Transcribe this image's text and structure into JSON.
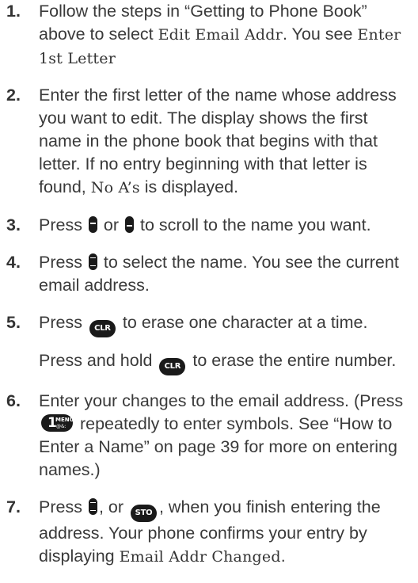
{
  "steps": [
    {
      "number": "1.",
      "text_a": "Follow the steps in “Getting to Phone Book” above to select ",
      "mono_a": "Edit Email Addr",
      "text_b": ". You see ",
      "mono_b": "Enter 1st Letter"
    },
    {
      "number": "2.",
      "text_a": "Enter the first letter of the name whose address you want to edit. The display shows the first name in the phone book that begins with that letter. If no entry beginning with that letter is found, ",
      "mono_a": "No A’s",
      "text_b": " is displayed."
    },
    {
      "number": "3.",
      "text_a": "Press ",
      "text_b": " or ",
      "text_c": " to scroll to the name you want."
    },
    {
      "number": "4.",
      "text_a": "Press ",
      "text_b": " to select the name. You see the current email address."
    },
    {
      "number": "5.",
      "text_a": "Press ",
      "key_clr": "CLR",
      "text_b": " to erase one character at a time.",
      "text_c": "Press and hold ",
      "text_d": " to erase the entire number."
    },
    {
      "number": "6.",
      "text_a": "Enter your changes to the email address. (Press ",
      "key_one": "1",
      "key_menu": "MENU",
      "key_menu_sub": "@&:",
      "text_b": " repeatedly to enter symbols. See “How to Enter a Name” on page 39 for more on entering names.)"
    },
    {
      "number": "7.",
      "text_a": "Press ",
      "text_b": ", or ",
      "key_sto": "STO",
      "text_c": ", when you finish entering the address. Your phone confirms your entry by displaying ",
      "mono_a": "Email Addr Changed",
      "text_d": "."
    }
  ]
}
